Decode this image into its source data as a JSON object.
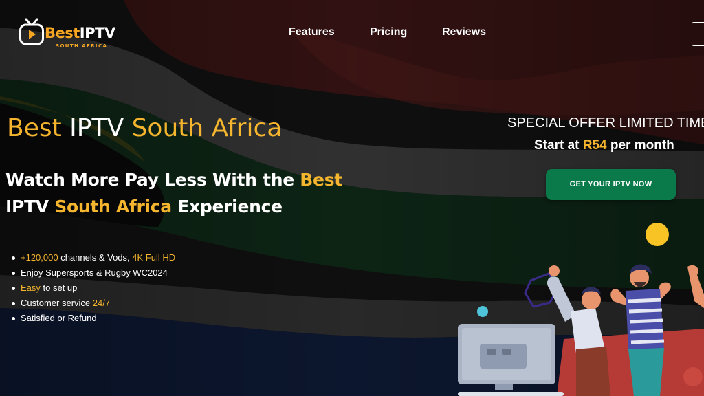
{
  "colors": {
    "accent": "#f5b52e",
    "cta_bg": "#0a7a4a",
    "background": "#141414"
  },
  "logo": {
    "best": "Best",
    "iptv": "IPTV",
    "subtitle": "SOUTH AFRICA",
    "icon": "tv-play-icon"
  },
  "nav": {
    "items": [
      {
        "label": "Features"
      },
      {
        "label": "Pricing"
      },
      {
        "label": "Reviews"
      }
    ]
  },
  "hero": {
    "title_part1": "Best",
    "title_part2": " IPTV ",
    "title_part3": "South Africa",
    "sub_part1": "Watch More Pay Less With the ",
    "sub_part2": "Best",
    "sub_part3": "IPTV ",
    "sub_part4": "South Africa",
    "sub_part5": " Experience"
  },
  "features": [
    {
      "hl": "+120,000",
      "text": " channels & Vods, ",
      "hl2": "4K Full HD"
    },
    {
      "hl": "",
      "text": "Enjoy Supersports & Rugby WC2024",
      "hl2": ""
    },
    {
      "hl": "Easy",
      "text": " to set up",
      "hl2": ""
    },
    {
      "hl": "",
      "text": "Customer service ",
      "hl2": "24/7"
    },
    {
      "hl": "",
      "text": "Satisfied or Refund",
      "hl2": ""
    }
  ],
  "offer": {
    "headline": "SPECIAL OFFER LIMITED TIME",
    "price_prefix": "Start at ",
    "price_value": "R54",
    "price_suffix": " per month",
    "cta_label": "GET YOUR IPTV NOW"
  }
}
